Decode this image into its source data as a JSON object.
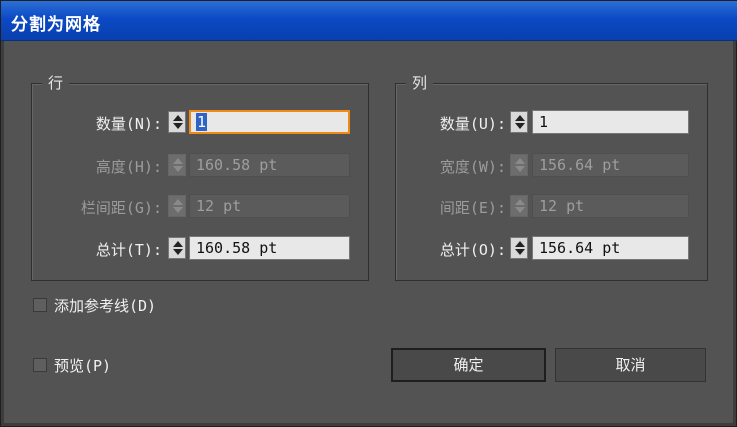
{
  "dialog": {
    "title": "分割为网格"
  },
  "rows_group": {
    "title": "行",
    "count": {
      "label": "数量(N):",
      "value": "1"
    },
    "height": {
      "label": "高度(H):",
      "value": "160.58 pt"
    },
    "gutter": {
      "label": "栏间距(G):",
      "value": "12 pt"
    },
    "total": {
      "label": "总计(T):",
      "value": "160.58 pt"
    }
  },
  "columns_group": {
    "title": "列",
    "count": {
      "label": "数量(U):",
      "value": "1"
    },
    "width": {
      "label": "宽度(W):",
      "value": "156.64 pt"
    },
    "gutter": {
      "label": "间距(E):",
      "value": "12 pt"
    },
    "total": {
      "label": "总计(O):",
      "value": "156.64 pt"
    }
  },
  "options": {
    "add_guides_label": "添加参考线(D)",
    "preview_label": "预览(P)",
    "add_guides_checked": false,
    "preview_checked": false
  },
  "buttons": {
    "ok": "确定",
    "cancel": "取消"
  },
  "icons": {
    "spinner": "spinner-arrows-icon"
  }
}
